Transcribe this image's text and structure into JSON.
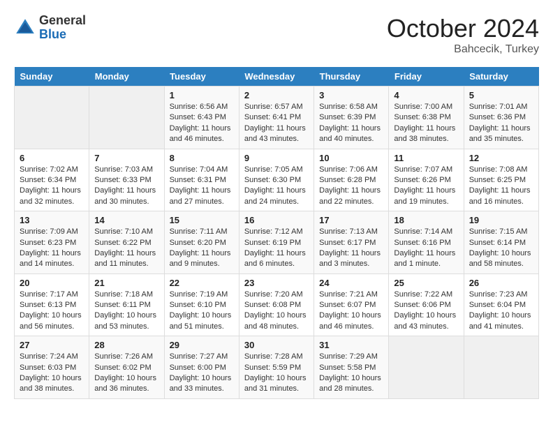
{
  "header": {
    "logo_line1": "General",
    "logo_line2": "Blue",
    "month": "October 2024",
    "location": "Bahcecik, Turkey"
  },
  "weekdays": [
    "Sunday",
    "Monday",
    "Tuesday",
    "Wednesday",
    "Thursday",
    "Friday",
    "Saturday"
  ],
  "weeks": [
    [
      {
        "day": "",
        "sunrise": "",
        "sunset": "",
        "daylight": ""
      },
      {
        "day": "",
        "sunrise": "",
        "sunset": "",
        "daylight": ""
      },
      {
        "day": "1",
        "sunrise": "Sunrise: 6:56 AM",
        "sunset": "Sunset: 6:43 PM",
        "daylight": "Daylight: 11 hours and 46 minutes."
      },
      {
        "day": "2",
        "sunrise": "Sunrise: 6:57 AM",
        "sunset": "Sunset: 6:41 PM",
        "daylight": "Daylight: 11 hours and 43 minutes."
      },
      {
        "day": "3",
        "sunrise": "Sunrise: 6:58 AM",
        "sunset": "Sunset: 6:39 PM",
        "daylight": "Daylight: 11 hours and 40 minutes."
      },
      {
        "day": "4",
        "sunrise": "Sunrise: 7:00 AM",
        "sunset": "Sunset: 6:38 PM",
        "daylight": "Daylight: 11 hours and 38 minutes."
      },
      {
        "day": "5",
        "sunrise": "Sunrise: 7:01 AM",
        "sunset": "Sunset: 6:36 PM",
        "daylight": "Daylight: 11 hours and 35 minutes."
      }
    ],
    [
      {
        "day": "6",
        "sunrise": "Sunrise: 7:02 AM",
        "sunset": "Sunset: 6:34 PM",
        "daylight": "Daylight: 11 hours and 32 minutes."
      },
      {
        "day": "7",
        "sunrise": "Sunrise: 7:03 AM",
        "sunset": "Sunset: 6:33 PM",
        "daylight": "Daylight: 11 hours and 30 minutes."
      },
      {
        "day": "8",
        "sunrise": "Sunrise: 7:04 AM",
        "sunset": "Sunset: 6:31 PM",
        "daylight": "Daylight: 11 hours and 27 minutes."
      },
      {
        "day": "9",
        "sunrise": "Sunrise: 7:05 AM",
        "sunset": "Sunset: 6:30 PM",
        "daylight": "Daylight: 11 hours and 24 minutes."
      },
      {
        "day": "10",
        "sunrise": "Sunrise: 7:06 AM",
        "sunset": "Sunset: 6:28 PM",
        "daylight": "Daylight: 11 hours and 22 minutes."
      },
      {
        "day": "11",
        "sunrise": "Sunrise: 7:07 AM",
        "sunset": "Sunset: 6:26 PM",
        "daylight": "Daylight: 11 hours and 19 minutes."
      },
      {
        "day": "12",
        "sunrise": "Sunrise: 7:08 AM",
        "sunset": "Sunset: 6:25 PM",
        "daylight": "Daylight: 11 hours and 16 minutes."
      }
    ],
    [
      {
        "day": "13",
        "sunrise": "Sunrise: 7:09 AM",
        "sunset": "Sunset: 6:23 PM",
        "daylight": "Daylight: 11 hours and 14 minutes."
      },
      {
        "day": "14",
        "sunrise": "Sunrise: 7:10 AM",
        "sunset": "Sunset: 6:22 PM",
        "daylight": "Daylight: 11 hours and 11 minutes."
      },
      {
        "day": "15",
        "sunrise": "Sunrise: 7:11 AM",
        "sunset": "Sunset: 6:20 PM",
        "daylight": "Daylight: 11 hours and 9 minutes."
      },
      {
        "day": "16",
        "sunrise": "Sunrise: 7:12 AM",
        "sunset": "Sunset: 6:19 PM",
        "daylight": "Daylight: 11 hours and 6 minutes."
      },
      {
        "day": "17",
        "sunrise": "Sunrise: 7:13 AM",
        "sunset": "Sunset: 6:17 PM",
        "daylight": "Daylight: 11 hours and 3 minutes."
      },
      {
        "day": "18",
        "sunrise": "Sunrise: 7:14 AM",
        "sunset": "Sunset: 6:16 PM",
        "daylight": "Daylight: 11 hours and 1 minute."
      },
      {
        "day": "19",
        "sunrise": "Sunrise: 7:15 AM",
        "sunset": "Sunset: 6:14 PM",
        "daylight": "Daylight: 10 hours and 58 minutes."
      }
    ],
    [
      {
        "day": "20",
        "sunrise": "Sunrise: 7:17 AM",
        "sunset": "Sunset: 6:13 PM",
        "daylight": "Daylight: 10 hours and 56 minutes."
      },
      {
        "day": "21",
        "sunrise": "Sunrise: 7:18 AM",
        "sunset": "Sunset: 6:11 PM",
        "daylight": "Daylight: 10 hours and 53 minutes."
      },
      {
        "day": "22",
        "sunrise": "Sunrise: 7:19 AM",
        "sunset": "Sunset: 6:10 PM",
        "daylight": "Daylight: 10 hours and 51 minutes."
      },
      {
        "day": "23",
        "sunrise": "Sunrise: 7:20 AM",
        "sunset": "Sunset: 6:08 PM",
        "daylight": "Daylight: 10 hours and 48 minutes."
      },
      {
        "day": "24",
        "sunrise": "Sunrise: 7:21 AM",
        "sunset": "Sunset: 6:07 PM",
        "daylight": "Daylight: 10 hours and 46 minutes."
      },
      {
        "day": "25",
        "sunrise": "Sunrise: 7:22 AM",
        "sunset": "Sunset: 6:06 PM",
        "daylight": "Daylight: 10 hours and 43 minutes."
      },
      {
        "day": "26",
        "sunrise": "Sunrise: 7:23 AM",
        "sunset": "Sunset: 6:04 PM",
        "daylight": "Daylight: 10 hours and 41 minutes."
      }
    ],
    [
      {
        "day": "27",
        "sunrise": "Sunrise: 7:24 AM",
        "sunset": "Sunset: 6:03 PM",
        "daylight": "Daylight: 10 hours and 38 minutes."
      },
      {
        "day": "28",
        "sunrise": "Sunrise: 7:26 AM",
        "sunset": "Sunset: 6:02 PM",
        "daylight": "Daylight: 10 hours and 36 minutes."
      },
      {
        "day": "29",
        "sunrise": "Sunrise: 7:27 AM",
        "sunset": "Sunset: 6:00 PM",
        "daylight": "Daylight: 10 hours and 33 minutes."
      },
      {
        "day": "30",
        "sunrise": "Sunrise: 7:28 AM",
        "sunset": "Sunset: 5:59 PM",
        "daylight": "Daylight: 10 hours and 31 minutes."
      },
      {
        "day": "31",
        "sunrise": "Sunrise: 7:29 AM",
        "sunset": "Sunset: 5:58 PM",
        "daylight": "Daylight: 10 hours and 28 minutes."
      },
      {
        "day": "",
        "sunrise": "",
        "sunset": "",
        "daylight": ""
      },
      {
        "day": "",
        "sunrise": "",
        "sunset": "",
        "daylight": ""
      }
    ]
  ]
}
